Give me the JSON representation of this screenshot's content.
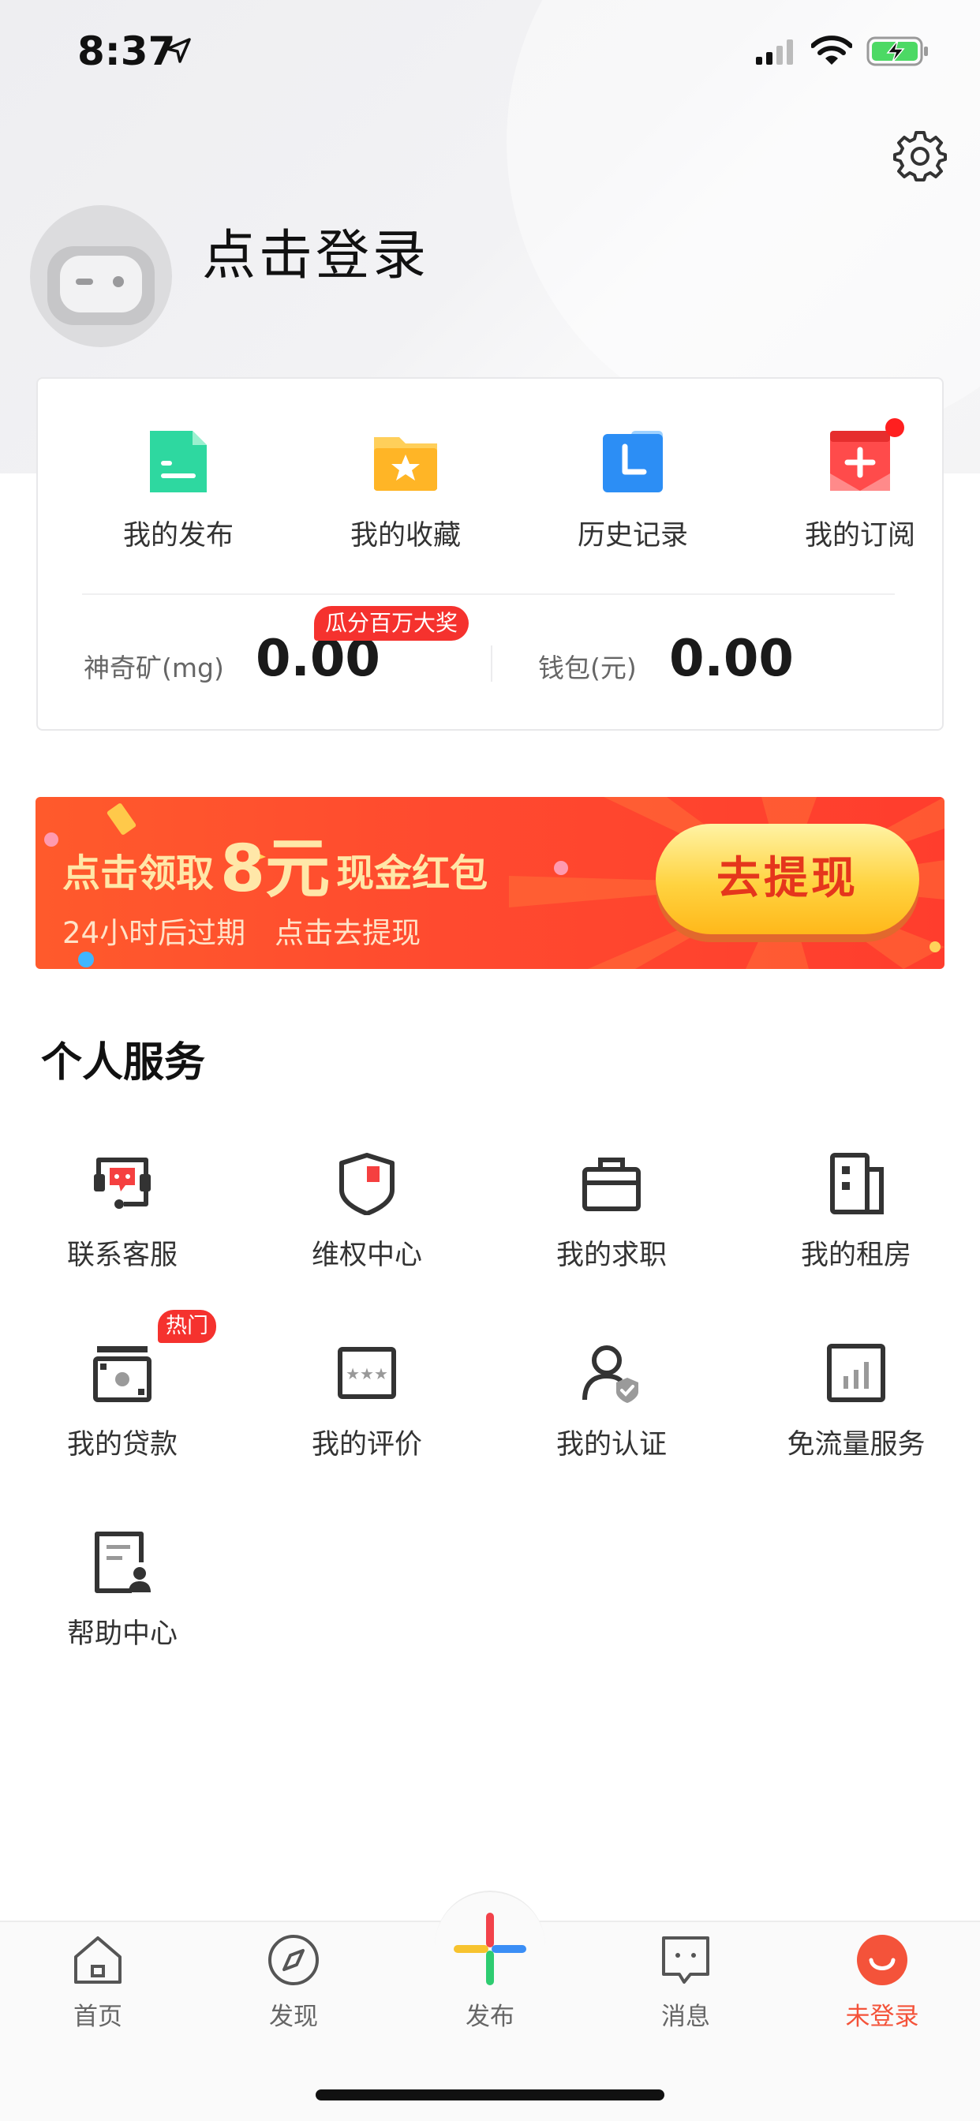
{
  "status_bar": {
    "time": "8:37"
  },
  "profile": {
    "login_prompt": "点击登录"
  },
  "quick_actions": [
    {
      "label": "我的发布",
      "icon": "document-icon"
    },
    {
      "label": "我的收藏",
      "icon": "star-folder-icon"
    },
    {
      "label": "历史记录",
      "icon": "clock-icon"
    },
    {
      "label": "我的订阅",
      "icon": "subscribe-icon",
      "has_dot": true
    }
  ],
  "metrics": {
    "mineral_label": "神奇矿(mg)",
    "mineral_value": "0.00",
    "mineral_badge": "瓜分百万大奖",
    "wallet_label": "钱包(元)",
    "wallet_value": "0.00"
  },
  "banner": {
    "prefix": "点击领取",
    "amount": "8元",
    "suffix": "现金红包",
    "subtitle": "24小时后过期　点击去提现",
    "button": "去提现"
  },
  "services": {
    "title": "个人服务",
    "items": [
      {
        "label": "联系客服",
        "icon": "customer-service-icon"
      },
      {
        "label": "维权中心",
        "icon": "shield-flag-icon"
      },
      {
        "label": "我的求职",
        "icon": "briefcase-icon"
      },
      {
        "label": "我的租房",
        "icon": "building-icon"
      },
      {
        "label": "我的贷款",
        "icon": "money-icon",
        "badge": "热门"
      },
      {
        "label": "我的评价",
        "icon": "rating-icon"
      },
      {
        "label": "我的认证",
        "icon": "verified-user-icon"
      },
      {
        "label": "免流量服务",
        "icon": "data-chart-icon"
      },
      {
        "label": "帮助中心",
        "icon": "help-doc-icon"
      }
    ]
  },
  "tab_bar": {
    "items": [
      {
        "label": "首页",
        "icon": "home-icon"
      },
      {
        "label": "发现",
        "icon": "compass-icon"
      },
      {
        "label": "发布",
        "icon": "plus-icon"
      },
      {
        "label": "消息",
        "icon": "message-icon"
      },
      {
        "label": "未登录",
        "icon": "user-smile-icon",
        "active": true
      }
    ]
  },
  "colors": {
    "accent": "#f4533a",
    "badge_red": "#f5322e",
    "banner_orange": "#ff4a2f",
    "button_yellow": "#ffd340"
  }
}
